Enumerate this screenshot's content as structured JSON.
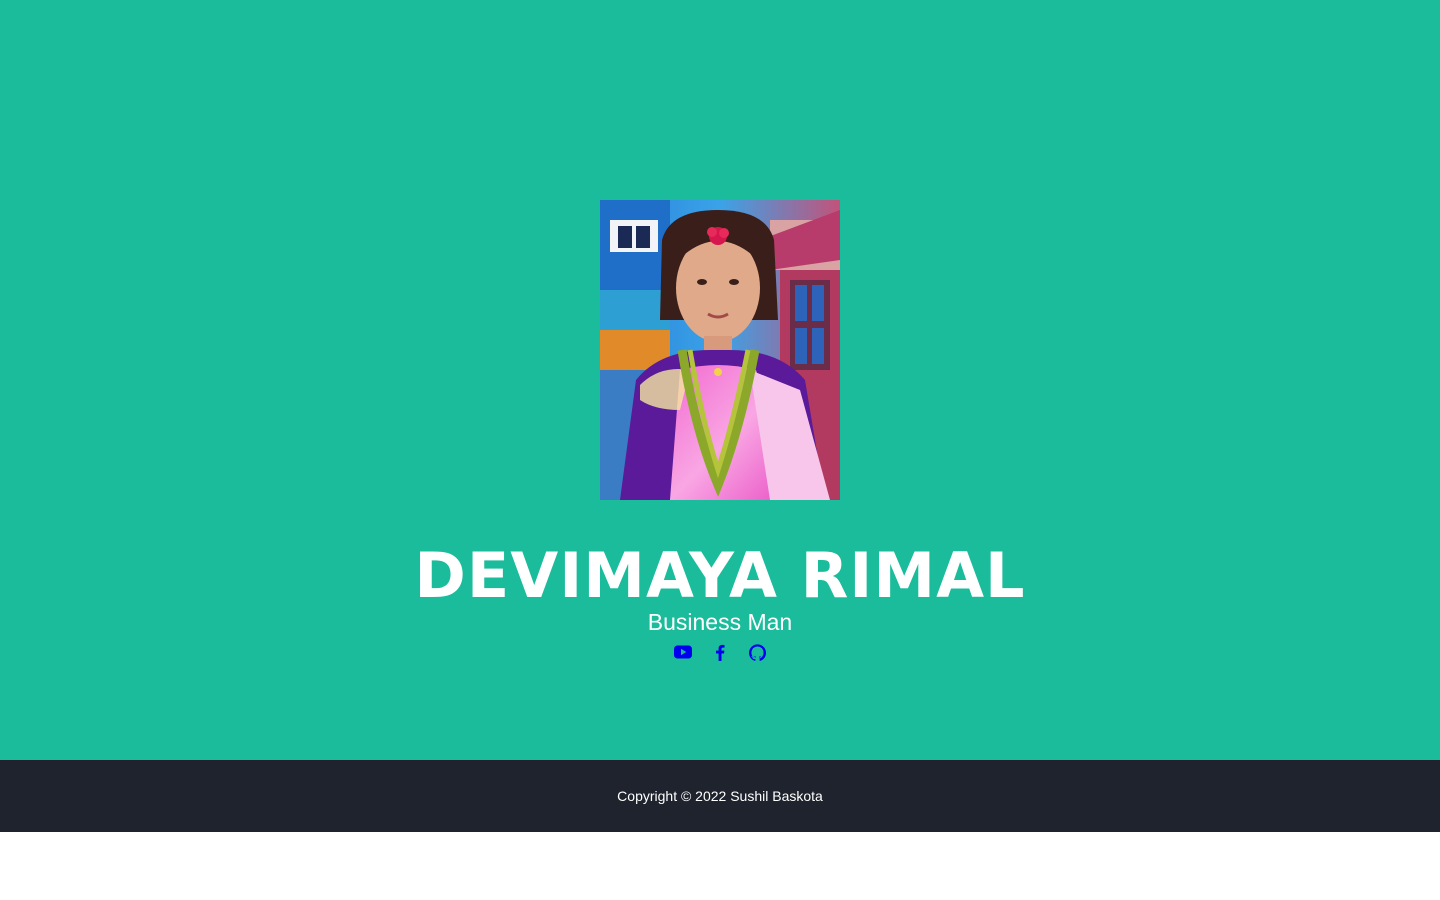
{
  "profile": {
    "name": "DEVIMAYA RIMAL",
    "subtitle": "Business Man",
    "portrait_alt": "Portrait of Devimaya Rimal"
  },
  "social_links": [
    {
      "icon": "youtube-icon",
      "label": "YouTube"
    },
    {
      "icon": "facebook-icon",
      "label": "Facebook"
    },
    {
      "icon": "github-icon",
      "label": "GitHub"
    }
  ],
  "footer": {
    "copyright": "Copyright © 2022 Sushil Baskota"
  },
  "colors": {
    "masthead_bg": "#1abc9c",
    "footer_bg": "#1e232d",
    "text": "#ffffff",
    "icon": "#0000ee"
  }
}
